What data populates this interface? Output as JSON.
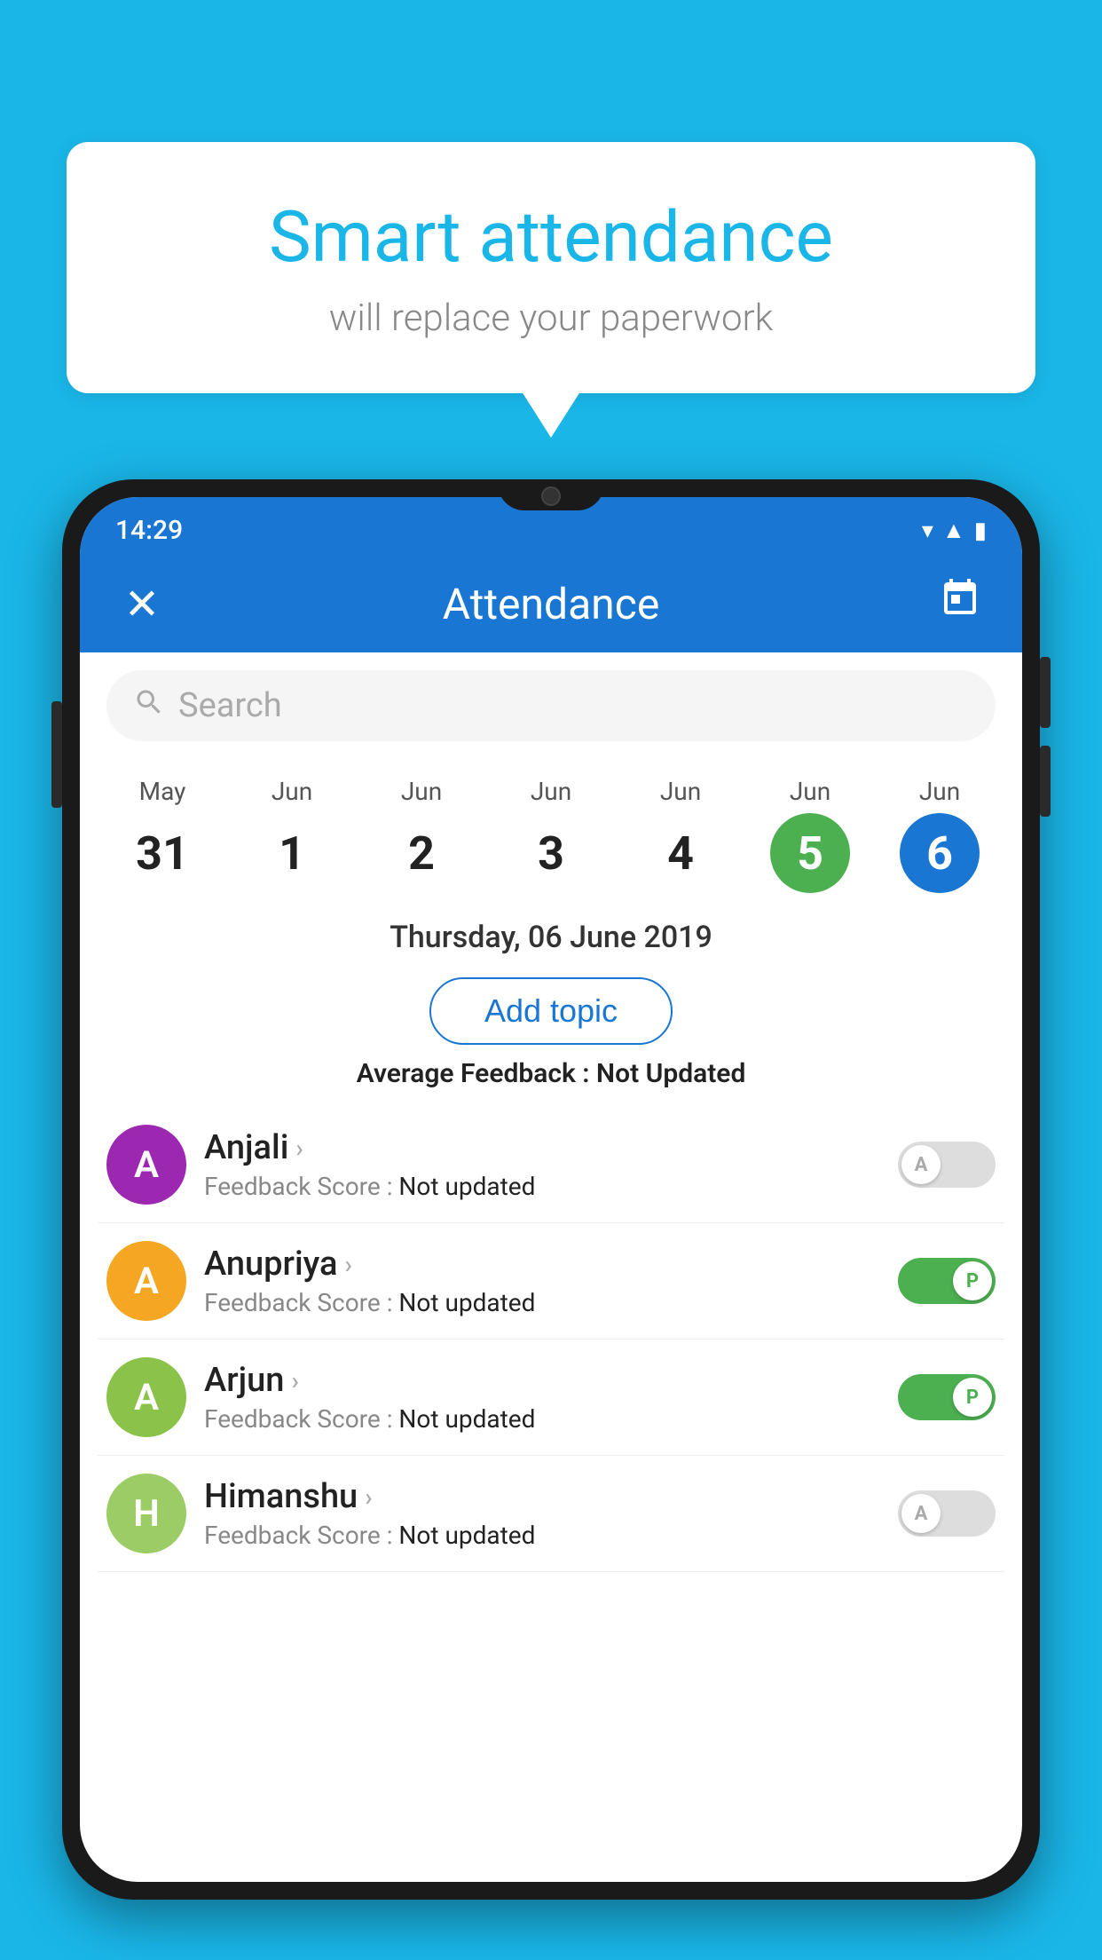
{
  "background_color": "#1ab6e8",
  "speech_bubble": {
    "title": "Smart attendance",
    "subtitle": "will replace your paperwork"
  },
  "phone": {
    "status_bar": {
      "time": "14:29",
      "icons": [
        "wifi",
        "signal",
        "battery"
      ]
    },
    "app_bar": {
      "close_icon": "✕",
      "title": "Attendance",
      "calendar_icon": "📅"
    },
    "search": {
      "placeholder": "Search"
    },
    "calendar": {
      "days": [
        {
          "month": "May",
          "date": "31",
          "selected": false
        },
        {
          "month": "Jun",
          "date": "1",
          "selected": false
        },
        {
          "month": "Jun",
          "date": "2",
          "selected": false
        },
        {
          "month": "Jun",
          "date": "3",
          "selected": false
        },
        {
          "month": "Jun",
          "date": "4",
          "selected": false
        },
        {
          "month": "Jun",
          "date": "5",
          "selected": "green"
        },
        {
          "month": "Jun",
          "date": "6",
          "selected": "blue"
        }
      ]
    },
    "selected_date": "Thursday, 06 June 2019",
    "add_topic_label": "Add topic",
    "avg_feedback_label": "Average Feedback :",
    "avg_feedback_value": "Not Updated",
    "students": [
      {
        "name": "Anjali",
        "initial": "A",
        "avatar_color": "#9c27b0",
        "feedback_label": "Feedback Score :",
        "feedback_value": "Not updated",
        "attendance": "A",
        "attendance_on": false
      },
      {
        "name": "Anupriya",
        "initial": "A",
        "avatar_color": "#f5a623",
        "feedback_label": "Feedback Score :",
        "feedback_value": "Not updated",
        "attendance": "P",
        "attendance_on": true
      },
      {
        "name": "Arjun",
        "initial": "A",
        "avatar_color": "#8bc34a",
        "feedback_label": "Feedback Score :",
        "feedback_value": "Not updated",
        "attendance": "P",
        "attendance_on": true
      },
      {
        "name": "Himanshu",
        "initial": "H",
        "avatar_color": "#9ccc65",
        "feedback_label": "Feedback Score :",
        "feedback_value": "Not updated",
        "attendance": "A",
        "attendance_on": false
      }
    ]
  }
}
